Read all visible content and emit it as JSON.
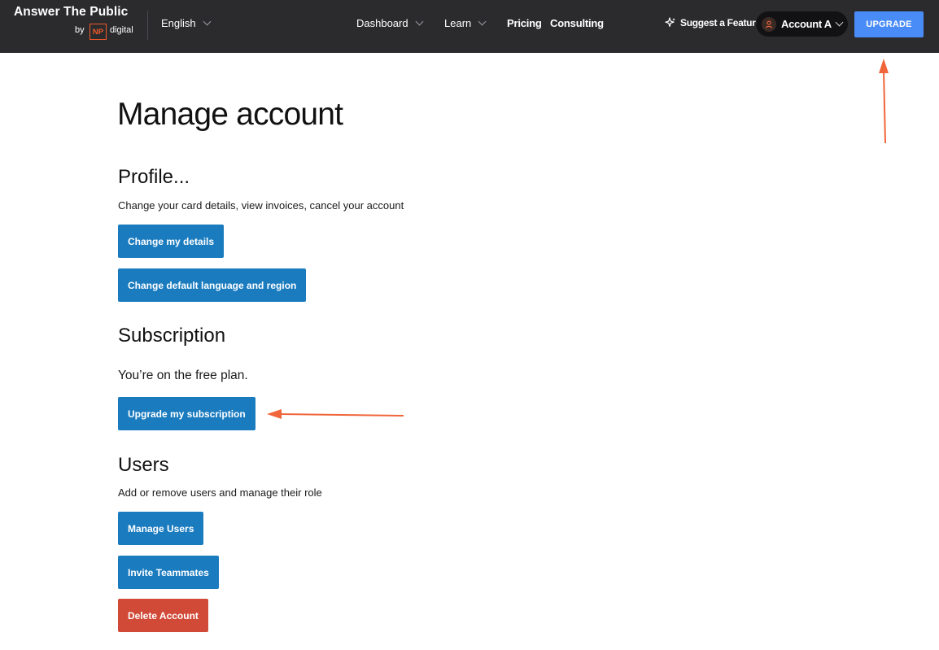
{
  "header": {
    "brand_name": "Answer The Public",
    "brand_by": "by",
    "brand_np": "NP",
    "brand_digital": "digital",
    "language": "English",
    "nav": {
      "dashboard": "Dashboard",
      "learn": "Learn",
      "pricing": "Pricing",
      "consulting": "Consulting"
    },
    "suggest_feature": "Suggest a Feature",
    "account_label": "Account A",
    "upgrade_label": "UPGRADE"
  },
  "main": {
    "title": "Manage account",
    "profile": {
      "title": "Profile...",
      "description": "Change your card details, view invoices, cancel your account",
      "change_details_button": "Change my details",
      "change_language_button": "Change default language and region"
    },
    "subscription": {
      "title": "Subscription",
      "plan_text": "You’re on the free plan.",
      "upgrade_button": "Upgrade my subscription"
    },
    "users": {
      "title": "Users",
      "description": "Add or remove users and manage their role",
      "manage_users_button": "Manage Users",
      "invite_button": "Invite Teammates",
      "delete_button": "Delete Account"
    }
  },
  "colors": {
    "header_bg": "#2b2b2e",
    "primary_button": "#1a7bbf",
    "danger_button": "#d14a38",
    "upgrade_accent": "#4a8cf7",
    "annotation_arrow": "#f0653a",
    "brand_orange": "#f05a28"
  }
}
